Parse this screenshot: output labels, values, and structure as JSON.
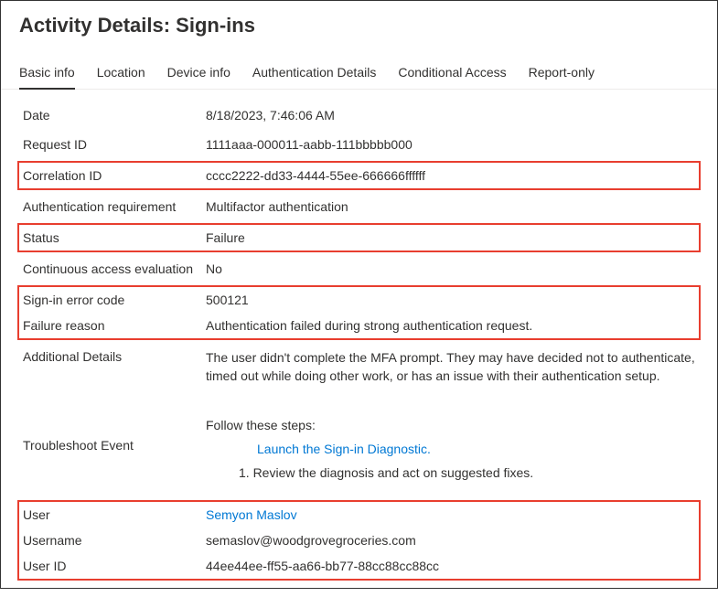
{
  "title": "Activity Details: Sign-ins",
  "tabs": [
    {
      "label": "Basic info",
      "active": true
    },
    {
      "label": "Location",
      "active": false
    },
    {
      "label": "Device info",
      "active": false
    },
    {
      "label": "Authentication Details",
      "active": false
    },
    {
      "label": "Conditional Access",
      "active": false
    },
    {
      "label": "Report-only",
      "active": false
    }
  ],
  "fields": {
    "date": {
      "label": "Date",
      "value": "8/18/2023, 7:46:06 AM"
    },
    "request_id": {
      "label": "Request ID",
      "value": "1111aaa-000011-aabb-111bbbbb000"
    },
    "correlation_id": {
      "label": "Correlation ID",
      "value": "cccc2222-dd33-4444-55ee-666666ffffff"
    },
    "auth_requirement": {
      "label": "Authentication requirement",
      "value": "Multifactor authentication"
    },
    "status": {
      "label": "Status",
      "value": "Failure"
    },
    "cae": {
      "label": "Continuous access evaluation",
      "value": "No"
    },
    "error_code": {
      "label": "Sign-in error code",
      "value": "500121"
    },
    "failure_reason": {
      "label": "Failure reason",
      "value": "Authentication failed during strong authentication request."
    },
    "additional_details": {
      "label": "Additional Details",
      "value": "The user didn't complete the MFA prompt. They may have decided not to authenticate, timed out while doing other work, or has an issue with their authentication setup."
    },
    "troubleshoot": {
      "label": "Troubleshoot Event",
      "intro": "Follow these steps:",
      "link": "Launch the Sign-in Diagnostic.",
      "step1": "1. Review the diagnosis and act on suggested fixes."
    },
    "user": {
      "label": "User",
      "value": "Semyon Maslov"
    },
    "username": {
      "label": "Username",
      "value": "semaslov@woodgrovegroceries.com"
    },
    "user_id": {
      "label": "User ID",
      "value": "44ee44ee-ff55-aa66-bb77-88cc88cc88cc"
    }
  }
}
